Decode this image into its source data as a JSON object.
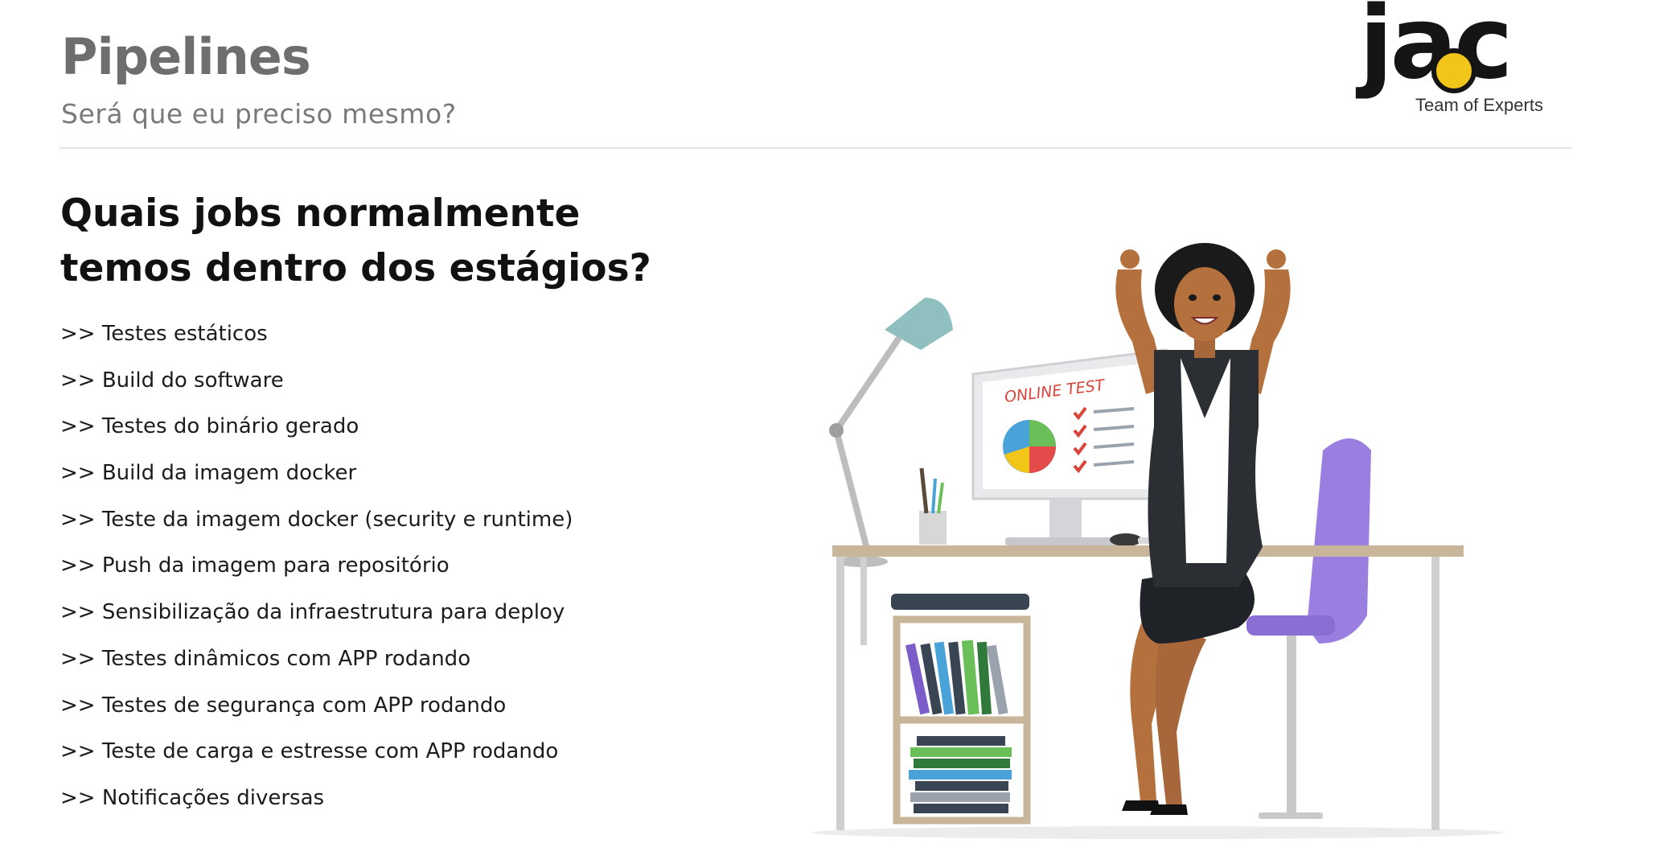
{
  "slide": {
    "title": "Pipelines",
    "subtitle": "Será que eu preciso mesmo?",
    "heading_line1": "Quais jobs normalmente",
    "heading_line2": "temos dentro dos estágios?",
    "jobs": [
      ">> Testes estáticos",
      ">> Build do software",
      ">> Testes do binário gerado",
      ">> Build da imagem docker",
      ">> Teste da imagem docker (security e runtime)",
      ">> Push da imagem para repositório",
      ">> Sensibilização da infraestrutura para deploy",
      ">> Testes dinâmicos com APP rodando",
      ">> Testes de segurança com APP rodando",
      ">> Teste de carga e estresse com APP rodando",
      ">> Notificações diversas"
    ]
  },
  "logo": {
    "word": "jac",
    "tagline": "Team of Experts",
    "accent_color": "#f2c519"
  },
  "illustration": {
    "monitor_text": "ONLINE TEST",
    "colors": {
      "chair": "#9b7fe0",
      "jacket": "#2b2f33",
      "desk": "#c9b59a",
      "lamp": "#8fbfbe",
      "checks": "#d9453b"
    }
  }
}
